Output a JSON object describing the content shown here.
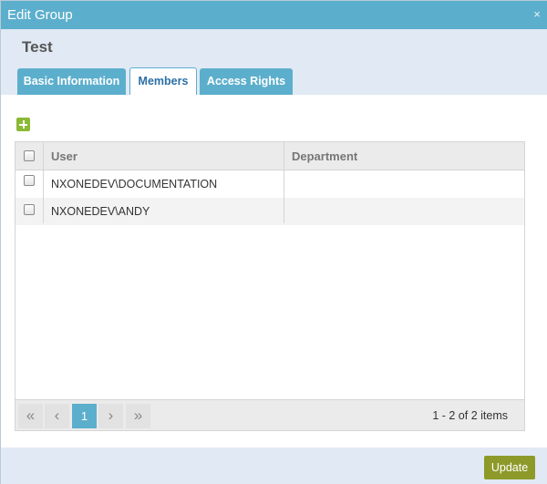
{
  "window": {
    "title": "Edit Group",
    "close_symbol": "×"
  },
  "group": {
    "name": "Test"
  },
  "tabs": [
    {
      "label": "Basic Information",
      "active": false
    },
    {
      "label": "Members",
      "active": true
    },
    {
      "label": "Access Rights",
      "active": false
    }
  ],
  "toolbar": {
    "add_icon": "plus-icon"
  },
  "grid": {
    "columns": [
      "User",
      "Department"
    ],
    "rows": [
      {
        "user": "NXONEDEV\\DOCUMENTATION",
        "department": ""
      },
      {
        "user": "NXONEDEV\\ANDY",
        "department": ""
      }
    ]
  },
  "pager": {
    "first": "«",
    "prev": "‹",
    "current_page": "1",
    "next": "›",
    "last": "»",
    "info": "1 - 2 of 2 items"
  },
  "footer": {
    "update_label": "Update"
  },
  "colors": {
    "titlebar": "#5cafcc",
    "band": "#e1e9f4",
    "add_button": "#8bb935",
    "update_button": "#8d9a2a"
  }
}
